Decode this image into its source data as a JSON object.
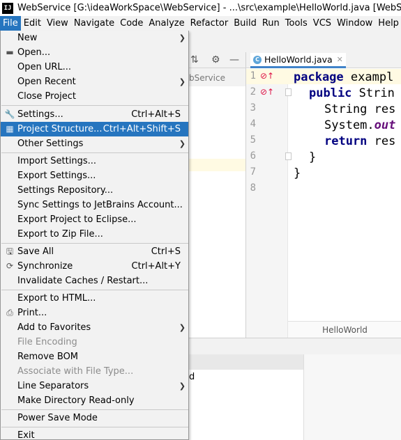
{
  "window": {
    "title": "WebService [G:\\ideaWorkSpace\\WebService] - ...\\src\\example\\HelloWorld.java [WebService] - I",
    "app_icon": "IJ"
  },
  "menubar": {
    "items": [
      "File",
      "Edit",
      "View",
      "Navigate",
      "Code",
      "Analyze",
      "Refactor",
      "Build",
      "Run",
      "Tools",
      "VCS",
      "Window",
      "Help"
    ],
    "active": "File"
  },
  "file_menu": {
    "new": "New",
    "open": "Open...",
    "open_url": "Open URL...",
    "open_recent": "Open Recent",
    "close_project": "Close Project",
    "settings": "Settings...",
    "settings_shortcut": "Ctrl+Alt+S",
    "project_structure": "Project Structure...",
    "project_structure_shortcut": "Ctrl+Alt+Shift+S",
    "other_settings": "Other Settings",
    "import_settings": "Import Settings...",
    "export_settings": "Export Settings...",
    "settings_repository": "Settings Repository...",
    "sync_settings": "Sync Settings to JetBrains Account...",
    "export_eclipse": "Export Project to Eclipse...",
    "export_zip": "Export to Zip File...",
    "save_all": "Save All",
    "save_all_shortcut": "Ctrl+S",
    "synchronize": "Synchronize",
    "synchronize_shortcut": "Ctrl+Alt+Y",
    "invalidate_caches": "Invalidate Caches / Restart...",
    "export_html": "Export to HTML...",
    "print": "Print...",
    "add_favorites": "Add to Favorites",
    "file_encoding": "File Encoding",
    "remove_bom": "Remove BOM",
    "associate_file_type": "Associate with File Type...",
    "line_separators": "Line Separators",
    "make_read_only": "Make Directory Read-only",
    "power_save": "Power Save Mode",
    "exit": "Exit"
  },
  "editor": {
    "tab_name": "HelloWorld.java",
    "breadcrumb": "HelloWorld",
    "line_numbers": [
      "1",
      "2",
      "3",
      "4",
      "5",
      "6",
      "7",
      "8"
    ],
    "code": {
      "l1_kw": "package",
      "l1_rest": " exampl",
      "l2_kw": "public",
      "l2_rest": " Strin",
      "l3": "String res",
      "l4_obj": "System.",
      "l4_fld": "out",
      "l5_kw": "return",
      "l5_rest": " res",
      "l6": "}",
      "l7": "}"
    }
  },
  "project_panel": {
    "label_fragment": "bService"
  },
  "bottom_panel": {
    "fragment": "d"
  }
}
